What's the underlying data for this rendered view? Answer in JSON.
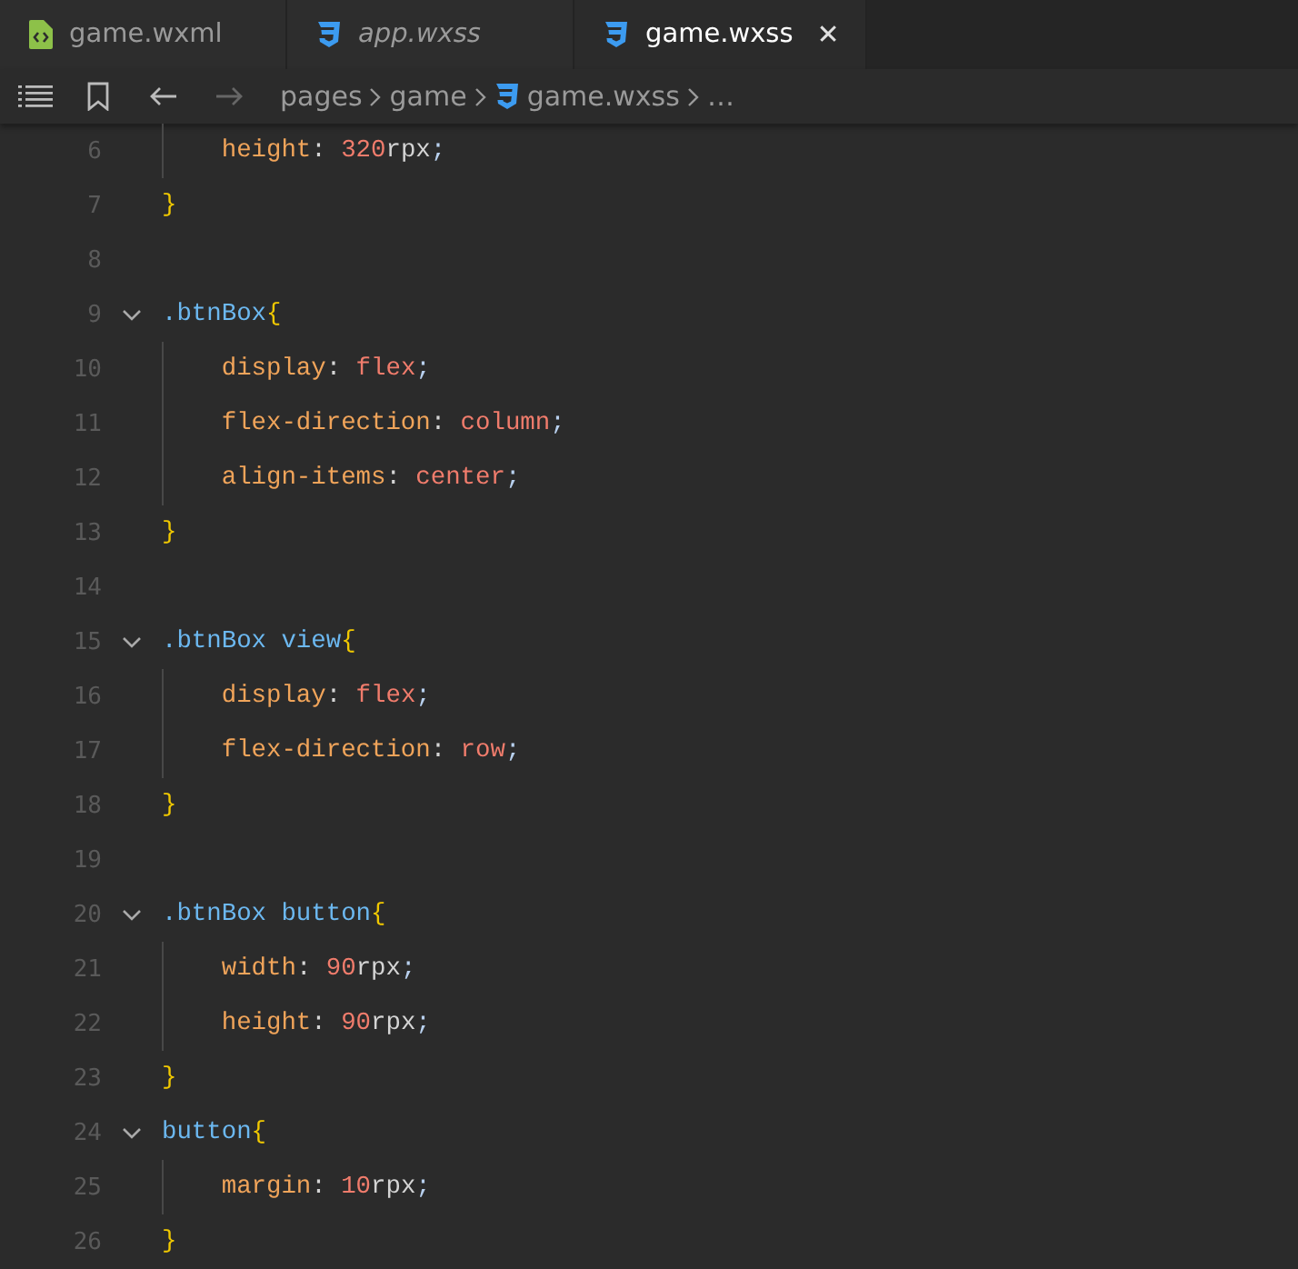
{
  "tabs": [
    {
      "label": "game.wxml",
      "kind": "wxml",
      "italic": false,
      "selected": false
    },
    {
      "label": "app.wxss",
      "kind": "css",
      "italic": true,
      "selected": false
    },
    {
      "label": "game.wxss",
      "kind": "css",
      "italic": false,
      "selected": true,
      "close": "✕"
    }
  ],
  "breadcrumb": {
    "parts": [
      {
        "label": "pages",
        "kind": "folder"
      },
      {
        "label": "game",
        "kind": "folder"
      },
      {
        "label": "game.wxss",
        "kind": "css"
      },
      {
        "label": "…",
        "kind": "more"
      }
    ]
  },
  "lines": [
    {
      "number": "6",
      "guide": true,
      "tokens": [
        {
          "text": "    height",
          "kind": "prop"
        },
        {
          "text": ": ",
          "kind": "punct"
        },
        {
          "text": "320",
          "kind": "num"
        },
        {
          "text": "rpx",
          "kind": "unit"
        },
        {
          "text": ";",
          "kind": "semi"
        }
      ]
    },
    {
      "number": "7",
      "tokens": [
        {
          "text": "}",
          "kind": "brace"
        }
      ]
    },
    {
      "number": "8"
    },
    {
      "number": "9",
      "folded": false,
      "tokens": [
        {
          "text": ".btnBox",
          "kind": "sel"
        },
        {
          "text": "{",
          "kind": "brace"
        }
      ]
    },
    {
      "number": "10",
      "guide": true,
      "tokens": [
        {
          "text": "    display",
          "kind": "prop"
        },
        {
          "text": ": ",
          "kind": "punct"
        },
        {
          "text": "flex",
          "kind": "val"
        },
        {
          "text": ";",
          "kind": "semi"
        }
      ]
    },
    {
      "number": "11",
      "guide": true,
      "tokens": [
        {
          "text": "    flex-direction",
          "kind": "prop"
        },
        {
          "text": ": ",
          "kind": "punct"
        },
        {
          "text": "column",
          "kind": "val"
        },
        {
          "text": ";",
          "kind": "semi"
        }
      ]
    },
    {
      "number": "12",
      "guide": true,
      "tokens": [
        {
          "text": "    align-items",
          "kind": "prop"
        },
        {
          "text": ": ",
          "kind": "punct"
        },
        {
          "text": "center",
          "kind": "val"
        },
        {
          "text": ";",
          "kind": "semi"
        }
      ]
    },
    {
      "number": "13",
      "tokens": [
        {
          "text": "}",
          "kind": "brace"
        }
      ]
    },
    {
      "number": "14"
    },
    {
      "number": "15",
      "folded": false,
      "tokens": [
        {
          "text": ".btnBox view",
          "kind": "sel"
        },
        {
          "text": "{",
          "kind": "brace"
        }
      ]
    },
    {
      "number": "16",
      "guide": true,
      "tokens": [
        {
          "text": "    display",
          "kind": "prop"
        },
        {
          "text": ": ",
          "kind": "punct"
        },
        {
          "text": "flex",
          "kind": "val"
        },
        {
          "text": ";",
          "kind": "semi"
        }
      ]
    },
    {
      "number": "17",
      "guide": true,
      "tokens": [
        {
          "text": "    flex-direction",
          "kind": "prop"
        },
        {
          "text": ": ",
          "kind": "punct"
        },
        {
          "text": "row",
          "kind": "val"
        },
        {
          "text": ";",
          "kind": "semi"
        }
      ]
    },
    {
      "number": "18",
      "tokens": [
        {
          "text": "}",
          "kind": "brace"
        }
      ]
    },
    {
      "number": "19"
    },
    {
      "number": "20",
      "folded": false,
      "tokens": [
        {
          "text": ".btnBox button",
          "kind": "sel"
        },
        {
          "text": "{",
          "kind": "brace"
        }
      ]
    },
    {
      "number": "21",
      "guide": true,
      "tokens": [
        {
          "text": "    width",
          "kind": "prop"
        },
        {
          "text": ": ",
          "kind": "punct"
        },
        {
          "text": "90",
          "kind": "num"
        },
        {
          "text": "rpx",
          "kind": "unit"
        },
        {
          "text": ";",
          "kind": "semi"
        }
      ]
    },
    {
      "number": "22",
      "guide": true,
      "tokens": [
        {
          "text": "    height",
          "kind": "prop"
        },
        {
          "text": ": ",
          "kind": "punct"
        },
        {
          "text": "90",
          "kind": "num"
        },
        {
          "text": "rpx",
          "kind": "unit"
        },
        {
          "text": ";",
          "kind": "semi"
        }
      ]
    },
    {
      "number": "23",
      "tokens": [
        {
          "text": "}",
          "kind": "brace"
        }
      ]
    },
    {
      "number": "24",
      "folded": false,
      "tokens": [
        {
          "text": "button",
          "kind": "sel"
        },
        {
          "text": "{",
          "kind": "brace"
        }
      ]
    },
    {
      "number": "25",
      "guide": true,
      "tokens": [
        {
          "text": "    margin",
          "kind": "prop"
        },
        {
          "text": ": ",
          "kind": "punct"
        },
        {
          "text": "10",
          "kind": "num"
        },
        {
          "text": "rpx",
          "kind": "unit"
        },
        {
          "text": ";",
          "kind": "semi"
        }
      ]
    },
    {
      "number": "26",
      "tokens": [
        {
          "text": "}",
          "kind": "brace"
        }
      ]
    }
  ]
}
